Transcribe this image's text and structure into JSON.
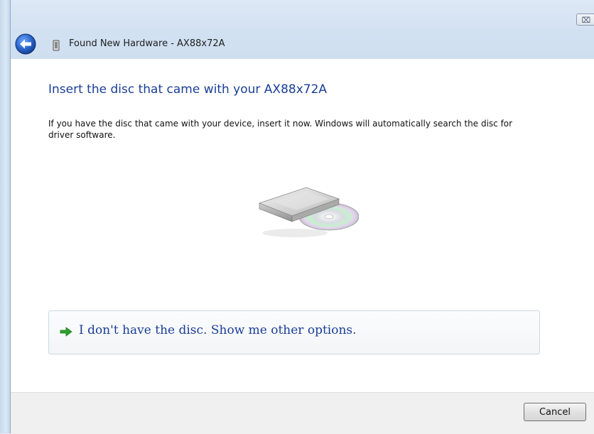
{
  "window": {
    "title": "Found New Hardware - AX88x72A",
    "close_glyph": "⌧"
  },
  "icons": {
    "back": "back-arrow-icon",
    "hardware": "hardware-device-icon",
    "disc": "disc-drive-icon",
    "option_arrow": "green-arrow-icon"
  },
  "content": {
    "heading": "Insert the disc that came with your AX88x72A",
    "description": "If you have the disc that came with your device, insert it now.  Windows will automatically search the disc for driver software."
  },
  "options": [
    {
      "label": "I don't have the disc.  Show me other options."
    }
  ],
  "footer": {
    "cancel_label": "Cancel"
  },
  "colors": {
    "heading_link": "#1a3e96",
    "option_arrow": "#2ea02e",
    "back_button": "#2a64c8"
  }
}
